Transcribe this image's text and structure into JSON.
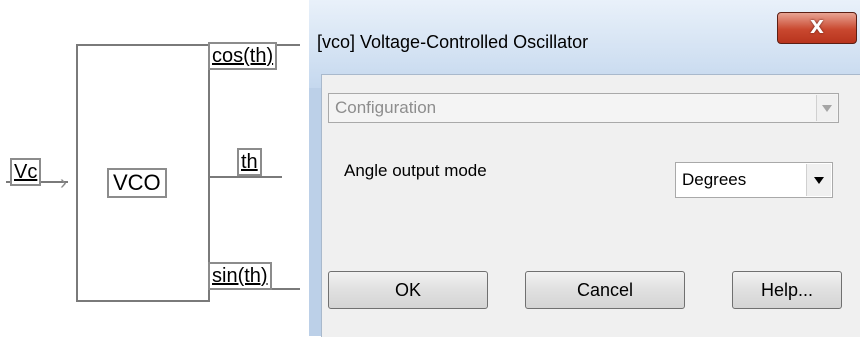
{
  "diagram": {
    "input_port": "Vc",
    "block_label": "VCO",
    "output_ports": [
      "cos(th)",
      "th",
      "sin(th)"
    ]
  },
  "dialog": {
    "title": "[vco] Voltage-Controlled Oscillator",
    "close_label": "X",
    "config_select": {
      "value": "Configuration",
      "enabled": false
    },
    "angle_mode": {
      "label": "Angle output mode",
      "value": "Degrees"
    },
    "buttons": {
      "ok": "OK",
      "cancel": "Cancel",
      "help": "Help..."
    }
  }
}
